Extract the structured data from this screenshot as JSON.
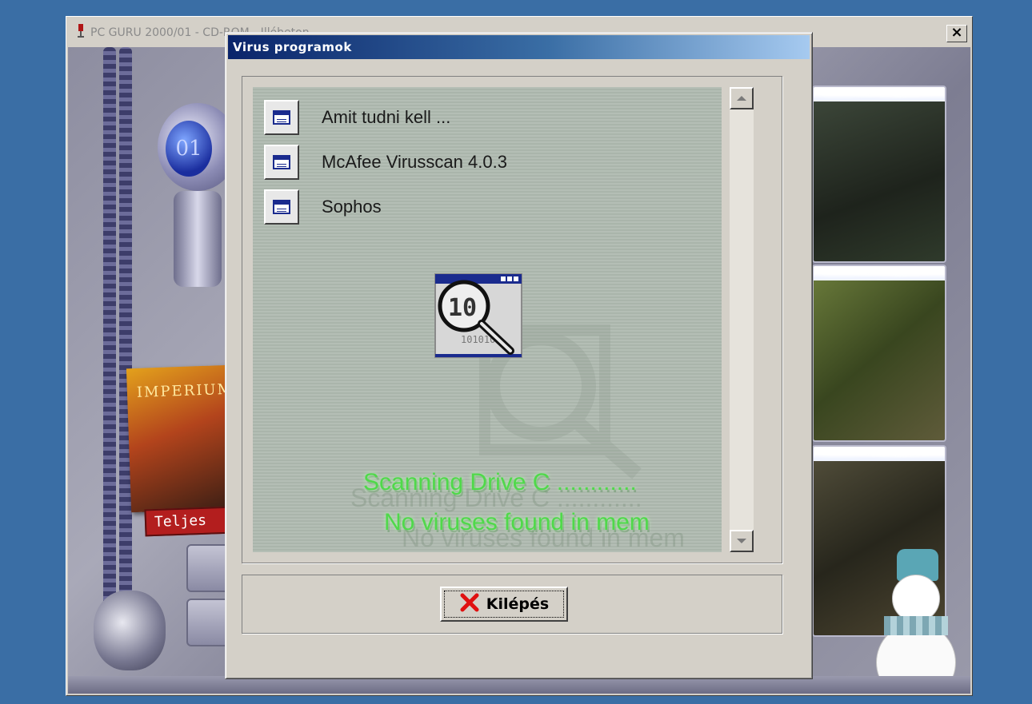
{
  "background_window": {
    "title": "PC GURU 2000/01 - CD-ROM - Illóbeton",
    "close_glyph": "×",
    "side_label": "Teljes",
    "game_box_text": "IMPERIUM"
  },
  "dialog": {
    "title": "Virus programok",
    "items": [
      {
        "label": "Amit tudni kell ..."
      },
      {
        "label": "McAfee Virusscan 4.0.3"
      },
      {
        "label": "Sophos"
      }
    ],
    "scan_text": {
      "line1": "Scanning Drive C ............",
      "line2": "No viruses found in mem"
    },
    "exit_button": {
      "label": "Kilépés"
    }
  },
  "colors": {
    "desktop": "#3a6ea5",
    "titlebar_start": "#0a246a",
    "titlebar_end": "#a6caf0",
    "scan_text": "#4fd94a",
    "exit_x": "#e01010"
  }
}
